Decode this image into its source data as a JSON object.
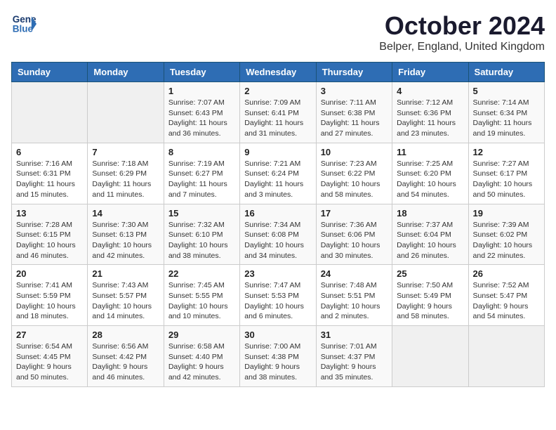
{
  "logo": {
    "line1": "General",
    "line2": "Blue"
  },
  "title": "October 2024",
  "location": "Belper, England, United Kingdom",
  "days_of_week": [
    "Sunday",
    "Monday",
    "Tuesday",
    "Wednesday",
    "Thursday",
    "Friday",
    "Saturday"
  ],
  "weeks": [
    [
      {
        "day": "",
        "info": ""
      },
      {
        "day": "",
        "info": ""
      },
      {
        "day": "1",
        "info": "Sunrise: 7:07 AM\nSunset: 6:43 PM\nDaylight: 11 hours and 36 minutes."
      },
      {
        "day": "2",
        "info": "Sunrise: 7:09 AM\nSunset: 6:41 PM\nDaylight: 11 hours and 31 minutes."
      },
      {
        "day": "3",
        "info": "Sunrise: 7:11 AM\nSunset: 6:38 PM\nDaylight: 11 hours and 27 minutes."
      },
      {
        "day": "4",
        "info": "Sunrise: 7:12 AM\nSunset: 6:36 PM\nDaylight: 11 hours and 23 minutes."
      },
      {
        "day": "5",
        "info": "Sunrise: 7:14 AM\nSunset: 6:34 PM\nDaylight: 11 hours and 19 minutes."
      }
    ],
    [
      {
        "day": "6",
        "info": "Sunrise: 7:16 AM\nSunset: 6:31 PM\nDaylight: 11 hours and 15 minutes."
      },
      {
        "day": "7",
        "info": "Sunrise: 7:18 AM\nSunset: 6:29 PM\nDaylight: 11 hours and 11 minutes."
      },
      {
        "day": "8",
        "info": "Sunrise: 7:19 AM\nSunset: 6:27 PM\nDaylight: 11 hours and 7 minutes."
      },
      {
        "day": "9",
        "info": "Sunrise: 7:21 AM\nSunset: 6:24 PM\nDaylight: 11 hours and 3 minutes."
      },
      {
        "day": "10",
        "info": "Sunrise: 7:23 AM\nSunset: 6:22 PM\nDaylight: 10 hours and 58 minutes."
      },
      {
        "day": "11",
        "info": "Sunrise: 7:25 AM\nSunset: 6:20 PM\nDaylight: 10 hours and 54 minutes."
      },
      {
        "day": "12",
        "info": "Sunrise: 7:27 AM\nSunset: 6:17 PM\nDaylight: 10 hours and 50 minutes."
      }
    ],
    [
      {
        "day": "13",
        "info": "Sunrise: 7:28 AM\nSunset: 6:15 PM\nDaylight: 10 hours and 46 minutes."
      },
      {
        "day": "14",
        "info": "Sunrise: 7:30 AM\nSunset: 6:13 PM\nDaylight: 10 hours and 42 minutes."
      },
      {
        "day": "15",
        "info": "Sunrise: 7:32 AM\nSunset: 6:10 PM\nDaylight: 10 hours and 38 minutes."
      },
      {
        "day": "16",
        "info": "Sunrise: 7:34 AM\nSunset: 6:08 PM\nDaylight: 10 hours and 34 minutes."
      },
      {
        "day": "17",
        "info": "Sunrise: 7:36 AM\nSunset: 6:06 PM\nDaylight: 10 hours and 30 minutes."
      },
      {
        "day": "18",
        "info": "Sunrise: 7:37 AM\nSunset: 6:04 PM\nDaylight: 10 hours and 26 minutes."
      },
      {
        "day": "19",
        "info": "Sunrise: 7:39 AM\nSunset: 6:02 PM\nDaylight: 10 hours and 22 minutes."
      }
    ],
    [
      {
        "day": "20",
        "info": "Sunrise: 7:41 AM\nSunset: 5:59 PM\nDaylight: 10 hours and 18 minutes."
      },
      {
        "day": "21",
        "info": "Sunrise: 7:43 AM\nSunset: 5:57 PM\nDaylight: 10 hours and 14 minutes."
      },
      {
        "day": "22",
        "info": "Sunrise: 7:45 AM\nSunset: 5:55 PM\nDaylight: 10 hours and 10 minutes."
      },
      {
        "day": "23",
        "info": "Sunrise: 7:47 AM\nSunset: 5:53 PM\nDaylight: 10 hours and 6 minutes."
      },
      {
        "day": "24",
        "info": "Sunrise: 7:48 AM\nSunset: 5:51 PM\nDaylight: 10 hours and 2 minutes."
      },
      {
        "day": "25",
        "info": "Sunrise: 7:50 AM\nSunset: 5:49 PM\nDaylight: 9 hours and 58 minutes."
      },
      {
        "day": "26",
        "info": "Sunrise: 7:52 AM\nSunset: 5:47 PM\nDaylight: 9 hours and 54 minutes."
      }
    ],
    [
      {
        "day": "27",
        "info": "Sunrise: 6:54 AM\nSunset: 4:45 PM\nDaylight: 9 hours and 50 minutes."
      },
      {
        "day": "28",
        "info": "Sunrise: 6:56 AM\nSunset: 4:42 PM\nDaylight: 9 hours and 46 minutes."
      },
      {
        "day": "29",
        "info": "Sunrise: 6:58 AM\nSunset: 4:40 PM\nDaylight: 9 hours and 42 minutes."
      },
      {
        "day": "30",
        "info": "Sunrise: 7:00 AM\nSunset: 4:38 PM\nDaylight: 9 hours and 38 minutes."
      },
      {
        "day": "31",
        "info": "Sunrise: 7:01 AM\nSunset: 4:37 PM\nDaylight: 9 hours and 35 minutes."
      },
      {
        "day": "",
        "info": ""
      },
      {
        "day": "",
        "info": ""
      }
    ]
  ]
}
